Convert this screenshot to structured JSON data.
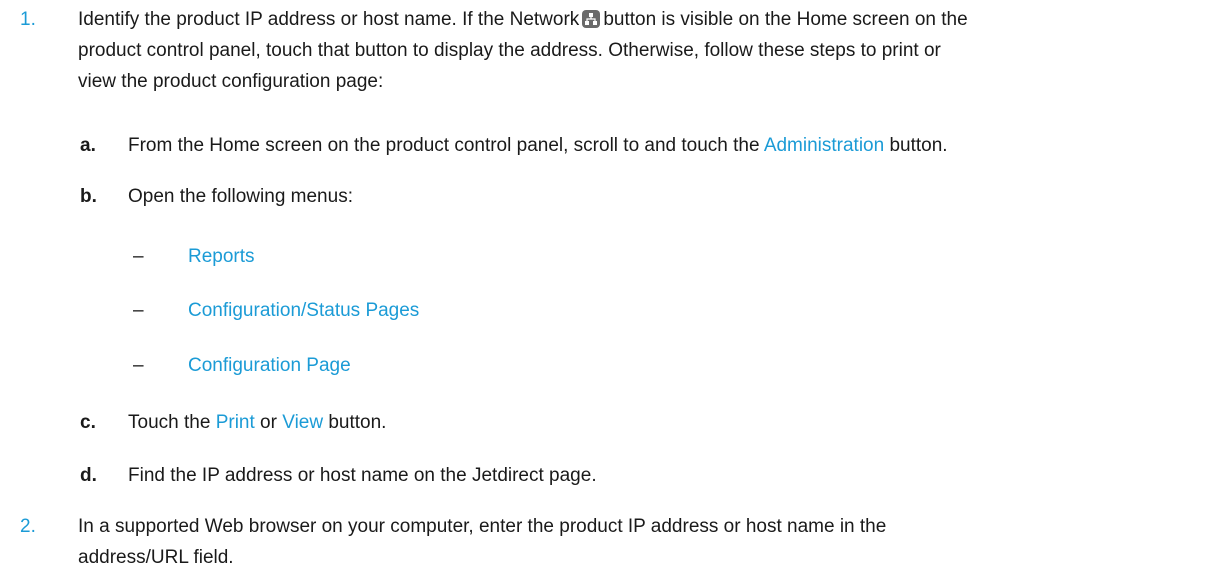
{
  "step1": {
    "number": "1.",
    "line1_before": "Identify the product IP address or host name. If the Network",
    "line1_after": "button is visible on the Home screen on the",
    "line2": "product control panel, touch that button to display the address. Otherwise, follow these steps to print or",
    "line3": "view the product configuration page:",
    "network_icon": "network-icon"
  },
  "sub_a": {
    "letter": "a.",
    "before": "From the Home screen on the product control panel, scroll to and touch the",
    "link": "Administration",
    "after": "button."
  },
  "sub_b": {
    "letter": "b.",
    "text": "Open the following menus:",
    "menus": [
      {
        "dash": "–",
        "label": "Reports"
      },
      {
        "dash": "–",
        "label": "Configuration/Status Pages"
      },
      {
        "dash": "–",
        "label": "Configuration Page"
      }
    ]
  },
  "sub_c": {
    "letter": "c.",
    "before": "Touch the",
    "link1": "Print",
    "middle": "or",
    "link2": "View",
    "after": "button."
  },
  "sub_d": {
    "letter": "d.",
    "text": "Find the IP address or host name on the Jetdirect page."
  },
  "step2": {
    "number": "2.",
    "line1": "In a supported Web browser on your computer, enter the product IP address or host name in the",
    "line2": "address/URL field."
  },
  "colors": {
    "accent": "#1b9bd6",
    "text": "#1a1a1a"
  }
}
